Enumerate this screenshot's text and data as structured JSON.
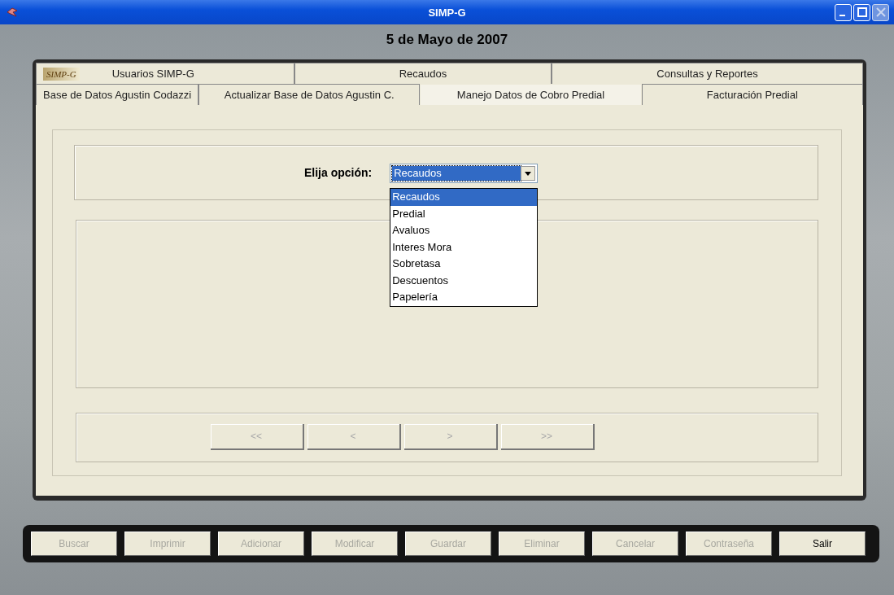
{
  "window": {
    "title": "SIMP-G"
  },
  "date": "5 de Mayo de 2007",
  "top_tabs": [
    {
      "label": "Usuarios SIMP-G",
      "selected": false,
      "logo": "SIMP-G"
    },
    {
      "label": "Recaudos",
      "selected": false
    },
    {
      "label": "Consultas y Reportes",
      "selected": false
    }
  ],
  "tabs": [
    {
      "label": "Base de Datos Agustin Codazzi",
      "selected": false
    },
    {
      "label": "Actualizar Base de Datos Agustin C.",
      "selected": false
    },
    {
      "label": "Manejo Datos de Cobro Predial",
      "selected": true
    },
    {
      "label": "Facturación Predial",
      "selected": false
    }
  ],
  "option": {
    "label": "Elija opción:",
    "value": "Recaudos",
    "expanded": true,
    "options": [
      {
        "label": "Recaudos",
        "selected": true
      },
      {
        "label": "Predial",
        "selected": false
      },
      {
        "label": "Avaluos",
        "selected": false
      },
      {
        "label": "Interes Mora",
        "selected": false
      },
      {
        "label": "Sobretasa",
        "selected": false
      },
      {
        "label": "Descuentos",
        "selected": false
      },
      {
        "label": "Papelería",
        "selected": false
      }
    ]
  },
  "navigation": [
    {
      "label": "<<",
      "disabled": true
    },
    {
      "label": "<",
      "disabled": true
    },
    {
      "label": ">",
      "disabled": true
    },
    {
      "label": ">>",
      "disabled": true
    }
  ],
  "buttons": [
    {
      "label": "Buscar",
      "disabled": true
    },
    {
      "label": "Imprimir",
      "disabled": true
    },
    {
      "label": "Adicionar",
      "disabled": true
    },
    {
      "label": "Modificar",
      "disabled": true
    },
    {
      "label": "Guardar",
      "disabled": true
    },
    {
      "label": "Eliminar",
      "disabled": true
    },
    {
      "label": "Cancelar",
      "disabled": true
    },
    {
      "label": "Contraseña",
      "disabled": true
    },
    {
      "label": "Salir",
      "disabled": false
    }
  ]
}
